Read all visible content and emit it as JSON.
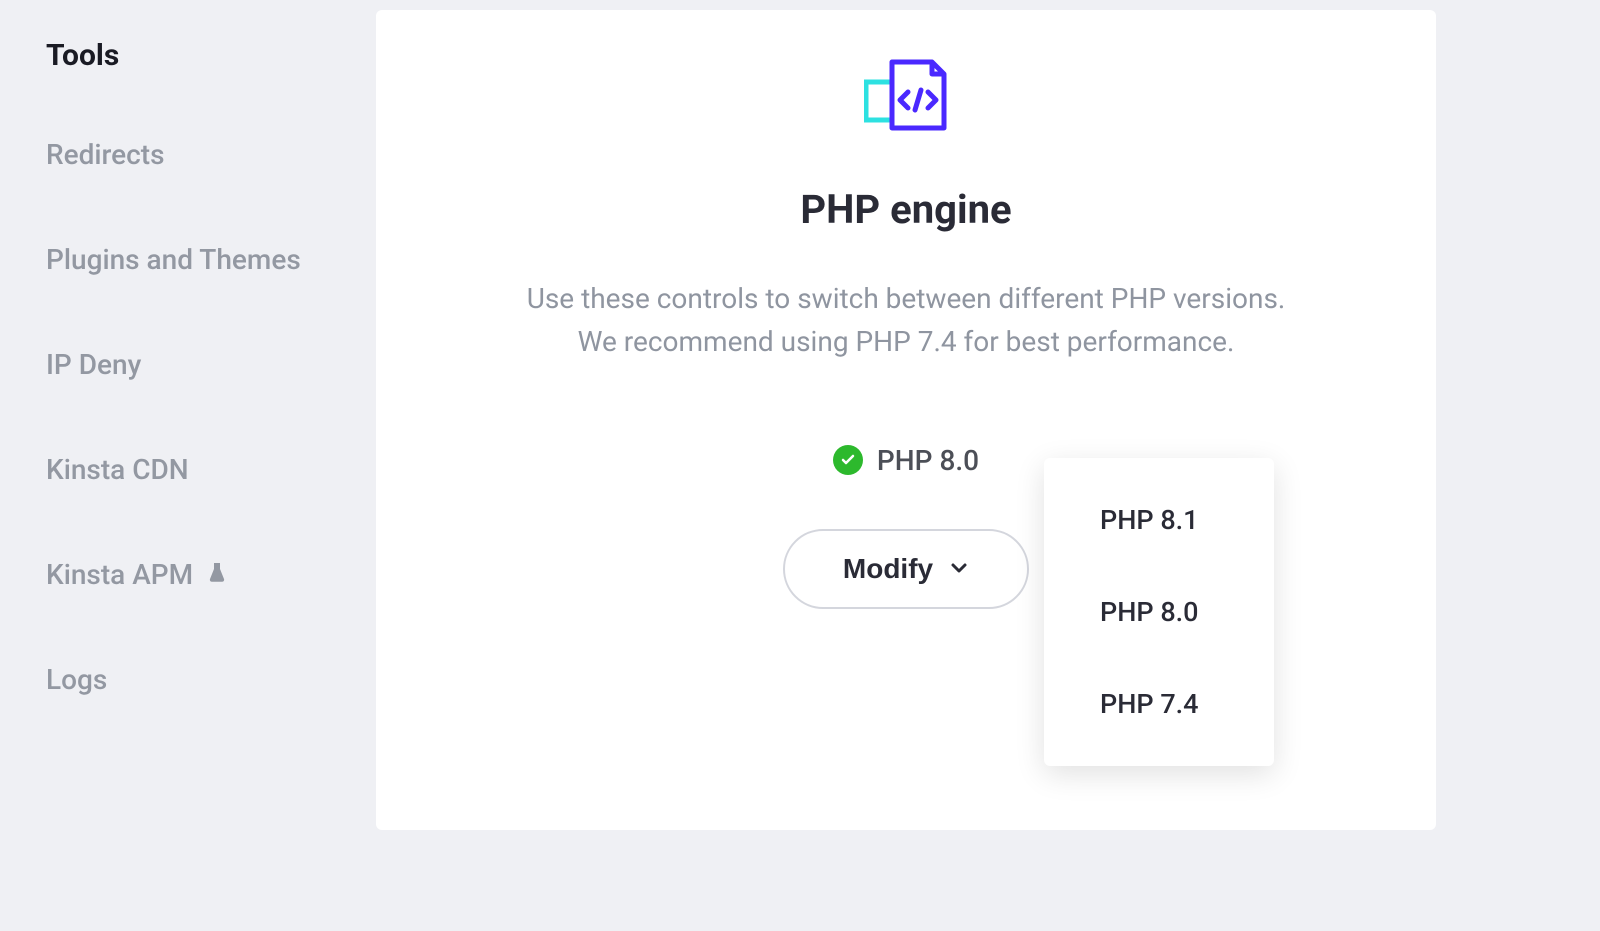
{
  "sidebar": {
    "active": "Tools",
    "items": [
      {
        "label": "Redirects"
      },
      {
        "label": "Plugins and Themes"
      },
      {
        "label": "IP Deny"
      },
      {
        "label": "Kinsta CDN"
      },
      {
        "label": "Kinsta APM",
        "hasIcon": true
      },
      {
        "label": "Logs"
      }
    ]
  },
  "main": {
    "title": "PHP engine",
    "description": "Use these controls to switch between different PHP versions. We recommend using PHP 7.4 for best performance.",
    "currentVersion": "PHP 8.0",
    "modifyLabel": "Modify",
    "dropdownOptions": [
      "PHP 8.1",
      "PHP 8.0",
      "PHP 7.4"
    ]
  }
}
